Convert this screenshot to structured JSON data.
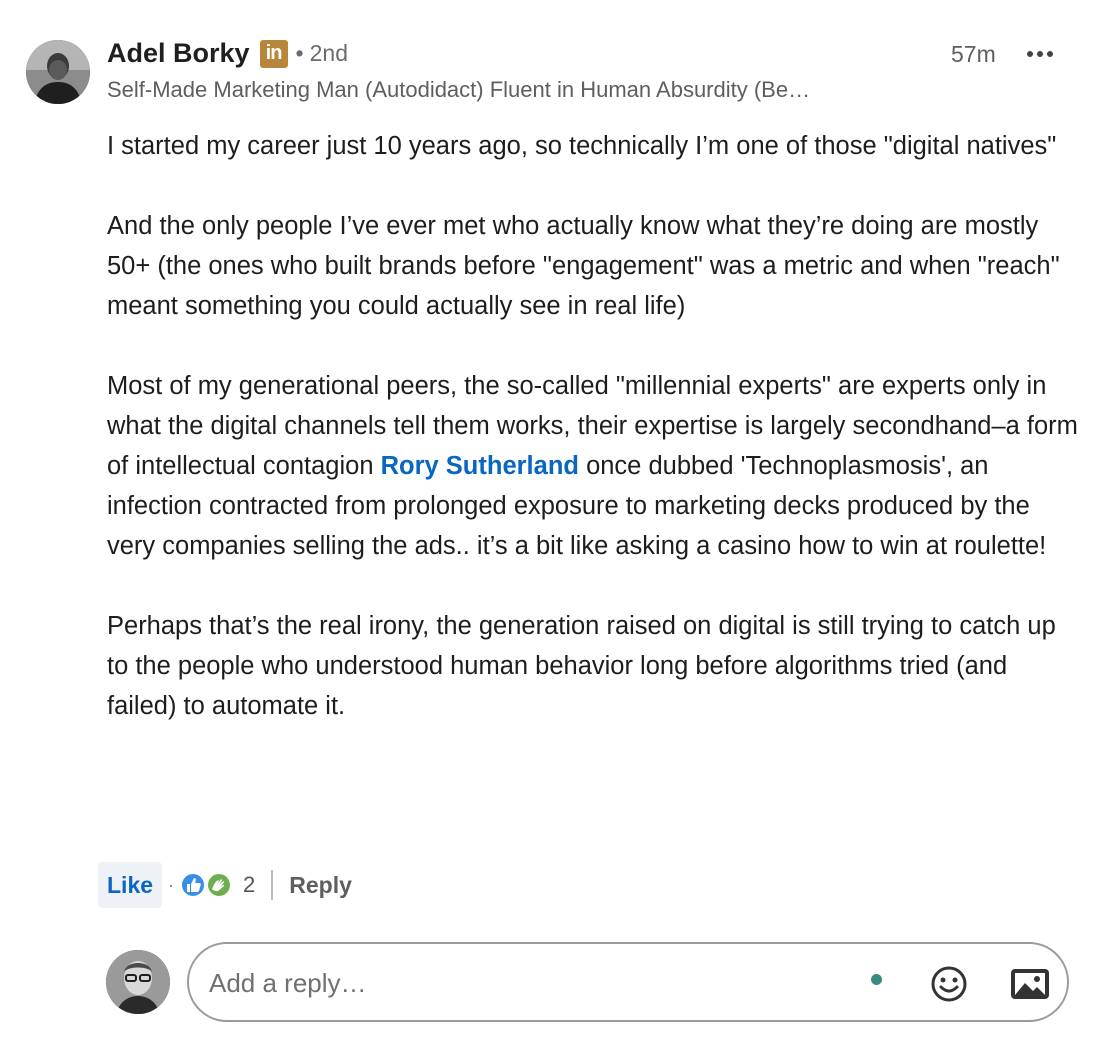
{
  "author": {
    "name": "Adel Borky",
    "badge": "in",
    "degree": "2nd",
    "headline": "Self-Made Marketing Man (Autodidact) Fluent in Human Absurdity (Be…",
    "time": "57m"
  },
  "body": {
    "p1": "I started my career just 10 years ago, so technically I’m one of those \"digital natives\"",
    "p2": "And the only people I’ve ever met who actually know what they’re doing are mostly 50+ (the ones who built brands before \"engagement\" was a metric and when \"reach\" meant something you could actually see in real life)",
    "p3_before": "Most of my generational peers, the so-called \"millennial experts\" are experts only in what the digital channels tell them works, their expertise is largely secondhand–a form of intellectual contagion ",
    "p3_mention": "Rory Sutherland",
    "p3_after": " once dubbed 'Technoplasmosis', an infection contracted from prolonged exposure to marketing decks produced by the very companies selling the ads.. it’s a bit like asking a casino how to win at roulette!",
    "p4": "Perhaps that’s the real irony, the generation raised on digital is still trying to catch up to the people who understood human behavior long before algorithms tried (and failed) to automate it."
  },
  "actions": {
    "like_label": "Like",
    "separator": "·",
    "reaction_count": "2",
    "reply_label": "Reply"
  },
  "reply_box": {
    "placeholder": "Add a reply…"
  },
  "icons": {
    "more": "ellipsis-icon",
    "like_reaction": "thumbs-up-icon",
    "support_reaction": "clapping-hands-icon",
    "emoji": "smiley-icon",
    "image": "image-icon"
  },
  "colors": {
    "link_blue": "#0a66c2",
    "linkedin_badge": "#b8863a",
    "status_dot": "#3a8a83"
  }
}
